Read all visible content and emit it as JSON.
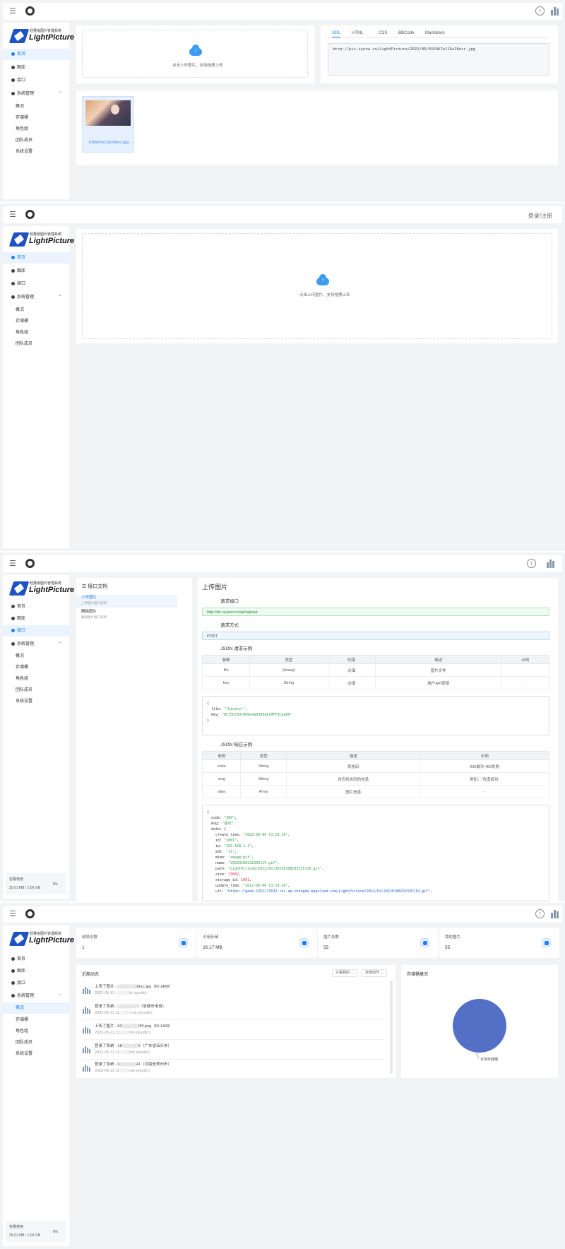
{
  "brand": {
    "subtitle": "轻量级图片管理系统",
    "name": "LightPicture"
  },
  "nav": {
    "home": "首页",
    "gallery": "图库",
    "api": "接口",
    "system": "系统管理",
    "overview": "概况",
    "storage": "存储桶",
    "roles": "角色组",
    "team": "团队成员",
    "settings": "系统设置"
  },
  "login": "登录/注册",
  "upload": {
    "hint": "点击上传图片，支持拖拽上传"
  },
  "links": {
    "tabs": [
      "URL",
      "HTML",
      "CSS",
      "BBCode",
      "Markdown"
    ],
    "value": "http://pic.xyaxw.cn/LightPicture/2022/05/016967e116c28ecc.jpg"
  },
  "uploaded": {
    "filename": "016967e116c28ecc.jpg"
  },
  "storage_usage": {
    "label": "容量使用",
    "value": "25.01 MB / 1.00 GB",
    "percent": "0%"
  },
  "apidoc": {
    "header": "接口文档",
    "items": [
      {
        "title": "上传图片",
        "desc": "上传图片接口说明"
      },
      {
        "title": "删除图片",
        "desc": "删除图片接口说明"
      }
    ],
    "title": "上传图片",
    "req_label": "请求接口",
    "req_url": "http://pic.xyaxw.cn/api/upload",
    "method_label": "请求方式",
    "method": "POST",
    "req_example_label": "JSON 请求示例",
    "req_columns": [
      "参数",
      "类型",
      "约束",
      "描述",
      "示例"
    ],
    "req_rows": [
      [
        "file",
        "(binary)",
        "必填",
        "图片文件",
        "-"
      ],
      [
        "key",
        "String",
        "必填",
        "用户API密钥",
        "-"
      ]
    ],
    "req_json": {
      "file_val": "\"(binary)\"",
      "key_val": "\"8C33b75Dc006e4a8309a619FF3Caa09\""
    },
    "res_example_label": "JSON 响应示例",
    "res_columns": [
      "参数",
      "类型",
      "描述",
      "示例"
    ],
    "res_rows": [
      [
        "code",
        "String",
        "状态码",
        "200成功 400失败"
      ],
      [
        "msg",
        "String",
        "对应状态码的信息",
        "例如：\"改造成功\""
      ],
      [
        "data",
        "Array",
        "图片信息",
        "-"
      ]
    ],
    "res_json": {
      "code": "\"200\"",
      "msg": "\"成功\"",
      "create_time": "\"2022-03-06 13:23:16\"",
      "id": "\"1001\"",
      "ip": "\"192.168.1.1\"",
      "mdt": "\"11\"",
      "mime": "\"image/gif\"",
      "name": "\"20220108232335119.gif\"",
      "path": "\"LightPicture/2022/01/20220108232335119.gif\"",
      "size": "13687",
      "storage_id": "1001",
      "update_time": "\"2022-03-06 13:23:16\"",
      "url": "\"https://geek-1252271632.cos.ap-chengdu.myqcloud.com/LightPicture/2022/01/20220108232335119.gif\""
    }
  },
  "dashboard": {
    "stats": [
      {
        "title": "成员总数",
        "value": "1"
      },
      {
        "title": "占用存储",
        "value": "26.17 MB"
      },
      {
        "title": "图片总数",
        "value": "55"
      },
      {
        "title": "我的图片",
        "value": "55"
      }
    ],
    "feed_title": "近期动态",
    "filter1": "只看我的",
    "filter2": "全部动作",
    "events": [
      {
        "action": "上传了图片 - ░░░░░░░8ecc.jpg（ID:1488）",
        "meta": "2022-05-11 ░░░░░lo (sycdtc)"
      },
      {
        "action": "登录了系统 - ░░░░░░░1（承德市电信）",
        "meta": "2022-05-11 11:░░░░min (sycdtc)"
      },
      {
        "action": "上传了图片 - 60░░░░░░0f0.png（ID:1468）",
        "meta": "2022-05-11 11:░░░min (sycdtc)"
      },
      {
        "action": "登录了系统 - 18░░░░░░9（广东省汕头市）",
        "meta": "2022-05-11 11:░░░min (sycdtc)"
      },
      {
        "action": "登录了系统 - 6░░░░░░41（河南省郑州市）",
        "meta": "2022-05-11 11:░░░min (sycdtc)"
      }
    ],
    "pie_title": "存储桶概况",
    "pie_label": "本地存储桶",
    "pie_color": "#5470c6"
  }
}
